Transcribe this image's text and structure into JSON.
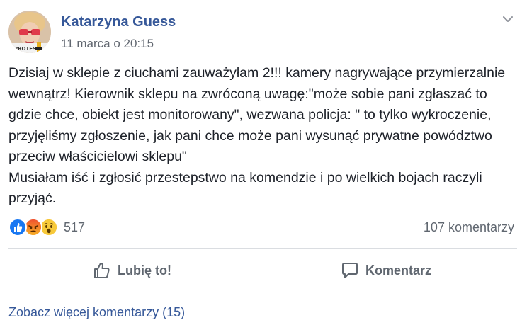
{
  "post": {
    "author": "Katarzyna Guess",
    "timestamp": "11 marca o 20:15",
    "avatar_badge": "PROTEST",
    "body_lines": [
      "Dzisiaj w sklepie z ciuchami zauważyłam 2!!! kamery nagrywające przymierzalnie wewnątrz! Kierownik sklepu na zwróconą uwagę:\"może sobie pani zgłaszać to gdzie chce, obiekt jest monitorowany\", wezwana policja: \" to tylko wykroczenie, przyjęliśmy zgłoszenie, jak pani chce może pani wysunąć prywatne powództwo przeciw właścicielowi sklepu\"",
      "Musiałam iść i zgłosić przestepstwo na komendzie i po wielkich bojach raczyli przyjąć."
    ]
  },
  "reactions": {
    "icons": [
      "like-reaction-icon",
      "angry-reaction-icon",
      "wow-reaction-icon"
    ],
    "count": "517",
    "comments_count": "107 komentarzy",
    "colors": {
      "like": "#1877f2",
      "angry": "#f25268",
      "wow": "#f7b125"
    }
  },
  "actions": {
    "like_label": "Lubię to!",
    "comment_label": "Komentarz"
  },
  "footer": {
    "more_comments": "Zobacz więcej komentarzy (15)"
  },
  "theme": {
    "link_color": "#365899",
    "text_color": "#1d2129",
    "muted_color": "#606770",
    "divider_color": "#dadde1"
  }
}
